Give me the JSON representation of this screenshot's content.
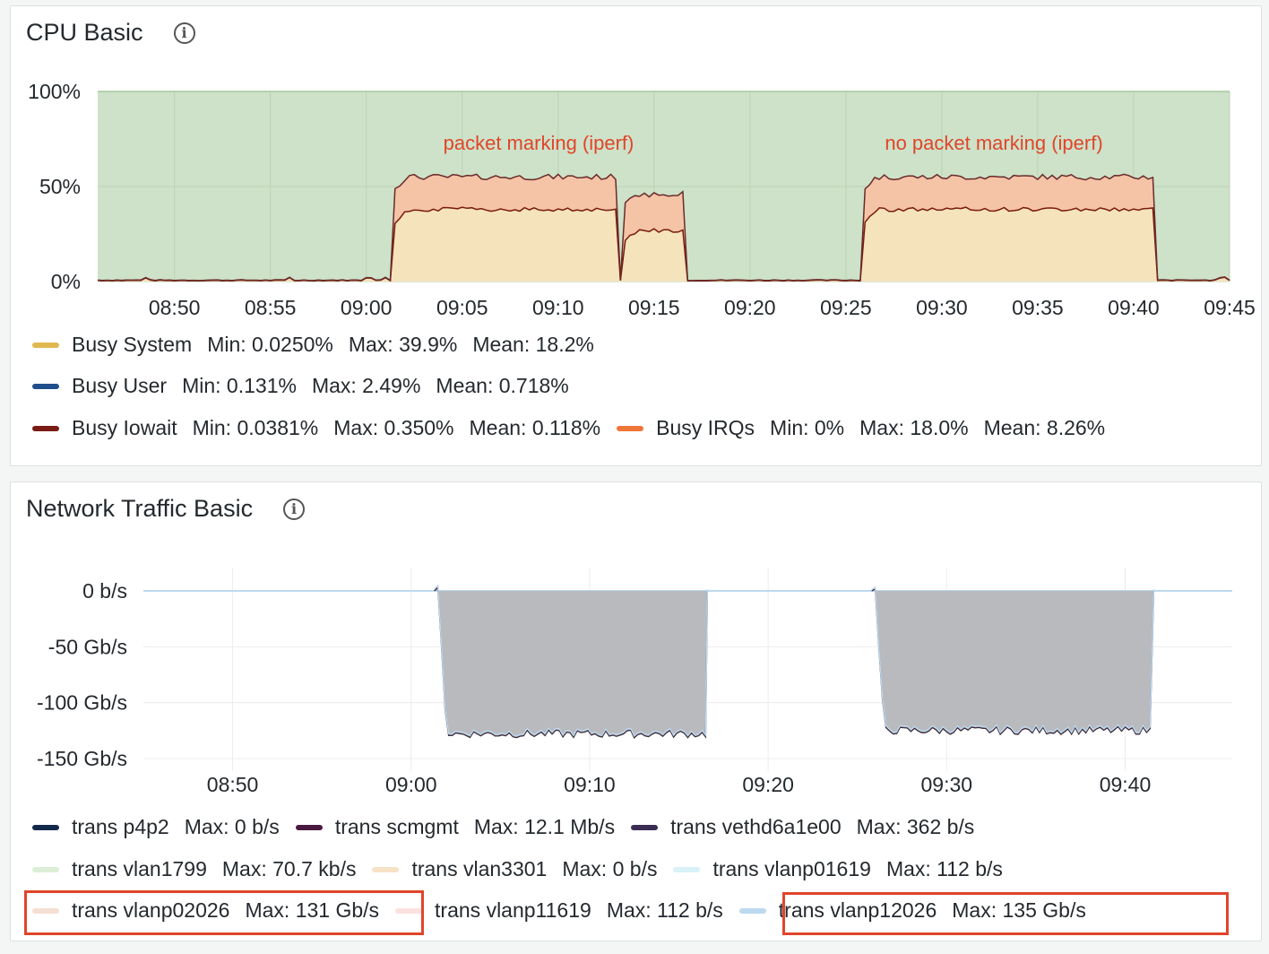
{
  "colors": {
    "busy_system": "#e0b84e",
    "busy_user": "#1f4e8c",
    "busy_iowait": "#7a1b15",
    "busy_irqs": "#f07638",
    "idle_fill": "#cde2c8",
    "system_fill": "#f5e3bb",
    "irq_fill": "#f5c4a7",
    "annotation": "#e0452b",
    "net_fill": "#b9babe",
    "highlight": "#e0452b"
  },
  "cpu_panel": {
    "title": "CPU Basic",
    "info_icon": "info-circle-icon",
    "annotations": [
      "packet marking (iperf)",
      "no packet marking (iperf)"
    ],
    "legend": [
      {
        "name": "Busy System",
        "min": "Min: 0.0250%",
        "max": "Max: 39.9%",
        "mean": "Mean: 18.2%"
      },
      {
        "name": "Busy User",
        "min": "Min: 0.131%",
        "max": "Max: 2.49%",
        "mean": "Mean: 0.718%"
      },
      {
        "name": "Busy Iowait",
        "min": "Min: 0.0381%",
        "max": "Max: 0.350%",
        "mean": "Mean: 0.118%"
      },
      {
        "name": "Busy IRQs",
        "min": "Min: 0%",
        "max": "Max: 18.0%",
        "mean": "Mean: 8.26%"
      }
    ]
  },
  "net_panel": {
    "title": "Network Traffic Basic",
    "info_icon": "info-circle-icon",
    "legend": [
      {
        "name": "trans p4p2",
        "max": "Max: 0 b/s",
        "color": "#13294b"
      },
      {
        "name": "trans scmgmt",
        "max": "Max: 12.1 Mb/s",
        "color": "#4a1942"
      },
      {
        "name": "trans vethd6a1e00",
        "max": "Max: 362 b/s",
        "color": "#3b2c52"
      },
      {
        "name": "trans vlan1799",
        "max": "Max: 70.7 kb/s",
        "color": "#dcefd6"
      },
      {
        "name": "trans vlan3301",
        "max": "Max: 0 b/s",
        "color": "#f7e2c6"
      },
      {
        "name": "trans vlanp01619",
        "max": "Max: 112 b/s",
        "color": "#d9f2f7"
      },
      {
        "name": "trans vlanp02026",
        "max": "Max: 131 Gb/s",
        "color": "#f5dfd2"
      },
      {
        "name": "trans vlanp11619",
        "max": "Max: 112 b/s",
        "color": "#fbe1e0"
      },
      {
        "name": "trans vlanp12026",
        "max": "Max: 135 Gb/s",
        "color": "#bcd9f0"
      }
    ]
  },
  "chart_data": [
    {
      "type": "area",
      "title": "CPU Basic",
      "x_ticks": [
        "08:50",
        "08:55",
        "09:00",
        "09:05",
        "09:10",
        "09:15",
        "09:20",
        "09:25",
        "09:30",
        "09:35",
        "09:40",
        "09:45"
      ],
      "y_ticks": [
        "100%",
        "50%",
        "0%"
      ],
      "ylim": [
        0,
        100
      ],
      "xlim": [
        "08:46",
        "09:45"
      ],
      "stacked": true,
      "segments": [
        {
          "from": "09:01.5",
          "to": "09:13",
          "busy_system": 38,
          "busy_total": 55
        },
        {
          "from": "09:13.5",
          "to": "09:16.5",
          "busy_system": 27,
          "busy_total": 46
        },
        {
          "from": "09:26",
          "to": "09:41",
          "busy_system": 38,
          "busy_total": 55
        }
      ],
      "series": [
        {
          "name": "Busy System",
          "min": 0.025,
          "max": 39.9,
          "mean": 18.2
        },
        {
          "name": "Busy User",
          "min": 0.131,
          "max": 2.49,
          "mean": 0.718
        },
        {
          "name": "Busy Iowait",
          "min": 0.0381,
          "max": 0.35,
          "mean": 0.118
        },
        {
          "name": "Busy IRQs",
          "min": 0,
          "max": 18.0,
          "mean": 8.26
        }
      ]
    },
    {
      "type": "area",
      "title": "Network Traffic Basic",
      "x_ticks": [
        "08:50",
        "09:00",
        "09:10",
        "09:20",
        "09:30",
        "09:40"
      ],
      "y_ticks": [
        "0 b/s",
        "-50 Gb/s",
        "-100 Gb/s",
        "-150 Gb/s"
      ],
      "ylim": [
        -150,
        0
      ],
      "y_unit": "Gb/s",
      "xlim": [
        "08:45",
        "09:46"
      ],
      "segments": [
        {
          "from": "09:01.5",
          "to": "09:16.5",
          "value": -128
        },
        {
          "from": "09:26",
          "to": "09:41.5",
          "value": -125
        }
      ]
    }
  ]
}
